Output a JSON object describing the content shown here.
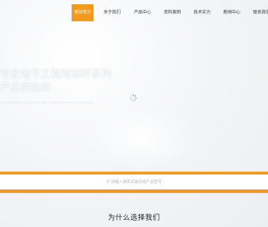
{
  "nav": {
    "items": [
      {
        "label": "网站首页",
        "active": true
      },
      {
        "label": "关于我们",
        "active": false
      },
      {
        "label": "产品中心",
        "active": false
      },
      {
        "label": "资料案例",
        "active": false
      },
      {
        "label": "技术实力",
        "active": false
      },
      {
        "label": "新闻中心",
        "active": false
      },
      {
        "label": "联系我们",
        "active": false
      }
    ]
  },
  "hero": {
    "title_line1": "专业地下工程用锚杆系列",
    "title_line2": "产品供应商",
    "subtitle": "PROFESSIONAL ANCHOR ROD SERIES PRODUCT SUPPLIER"
  },
  "search": {
    "hint": "请输入搜索关键词或产品型号"
  },
  "section": {
    "title": "为什么选择我们"
  },
  "colors": {
    "accent": "#f39a1d"
  }
}
